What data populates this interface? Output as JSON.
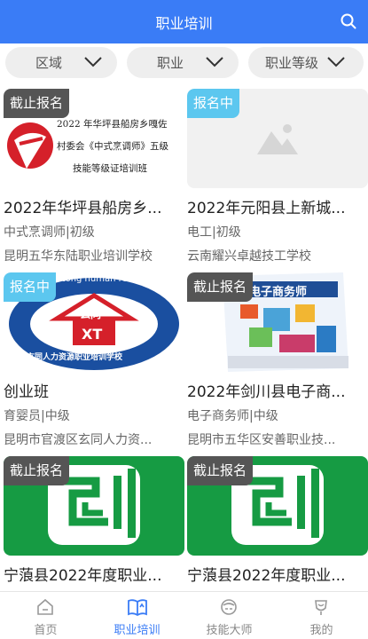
{
  "header": {
    "title": "职业培训"
  },
  "filters": [
    {
      "label": "区域"
    },
    {
      "label": "职业"
    },
    {
      "label": "职业等级"
    }
  ],
  "courses": [
    {
      "badge": "截止报名",
      "status": "closed",
      "title": "2022年华坪县船房乡...",
      "type": "中式烹调师|初级",
      "school": "昆明五华东陆职业培训学校",
      "image": "logo-poster",
      "poster_lines": [
        "2022 年华坪县船房乡嘎佐",
        "村委会《中式烹调师》五级",
        "技能等级证培训班"
      ]
    },
    {
      "badge": "报名中",
      "status": "open",
      "title": "2022年元阳县上新城...",
      "type": "电工|初级",
      "school": "云南耀兴卓越技工学校",
      "image": "placeholder"
    },
    {
      "badge": "报名中",
      "status": "open",
      "title": "创业班",
      "type": "育婴员|中级",
      "school": "昆明市官渡区玄同人力资...",
      "image": "school-logo",
      "logo_top": "Xuantong human resources school",
      "logo_mid": "玄同",
      "logo_code": "XT",
      "logo_bottom": "玄同人力资源职业培训学校"
    },
    {
      "badge": "截止报名",
      "status": "closed",
      "title": "2022年剑川县电子商...",
      "type": "电子商务师|中级",
      "school": "昆明市五华区安善职业技...",
      "image": "ecommerce-book",
      "book_title": "电子商务师"
    },
    {
      "badge": "截止报名",
      "status": "closed",
      "title": "宁蒗县2022年度职业...",
      "type": "",
      "school": "",
      "image": "green-logo"
    },
    {
      "badge": "截止报名",
      "status": "closed",
      "title": "宁蒗县2022年度职业...",
      "type": "",
      "school": "",
      "image": "green-logo"
    }
  ],
  "tabs": [
    {
      "label": "首页",
      "icon": "home-icon",
      "active": false
    },
    {
      "label": "职业培训",
      "icon": "book-icon",
      "active": true
    },
    {
      "label": "技能大师",
      "icon": "master-icon",
      "active": false
    },
    {
      "label": "我的",
      "icon": "profile-icon",
      "active": false
    }
  ],
  "colors": {
    "accent": "#3a7cf6",
    "badge_closed": "#555555",
    "badge_open": "#5cc7ef",
    "green": "#169b43"
  }
}
